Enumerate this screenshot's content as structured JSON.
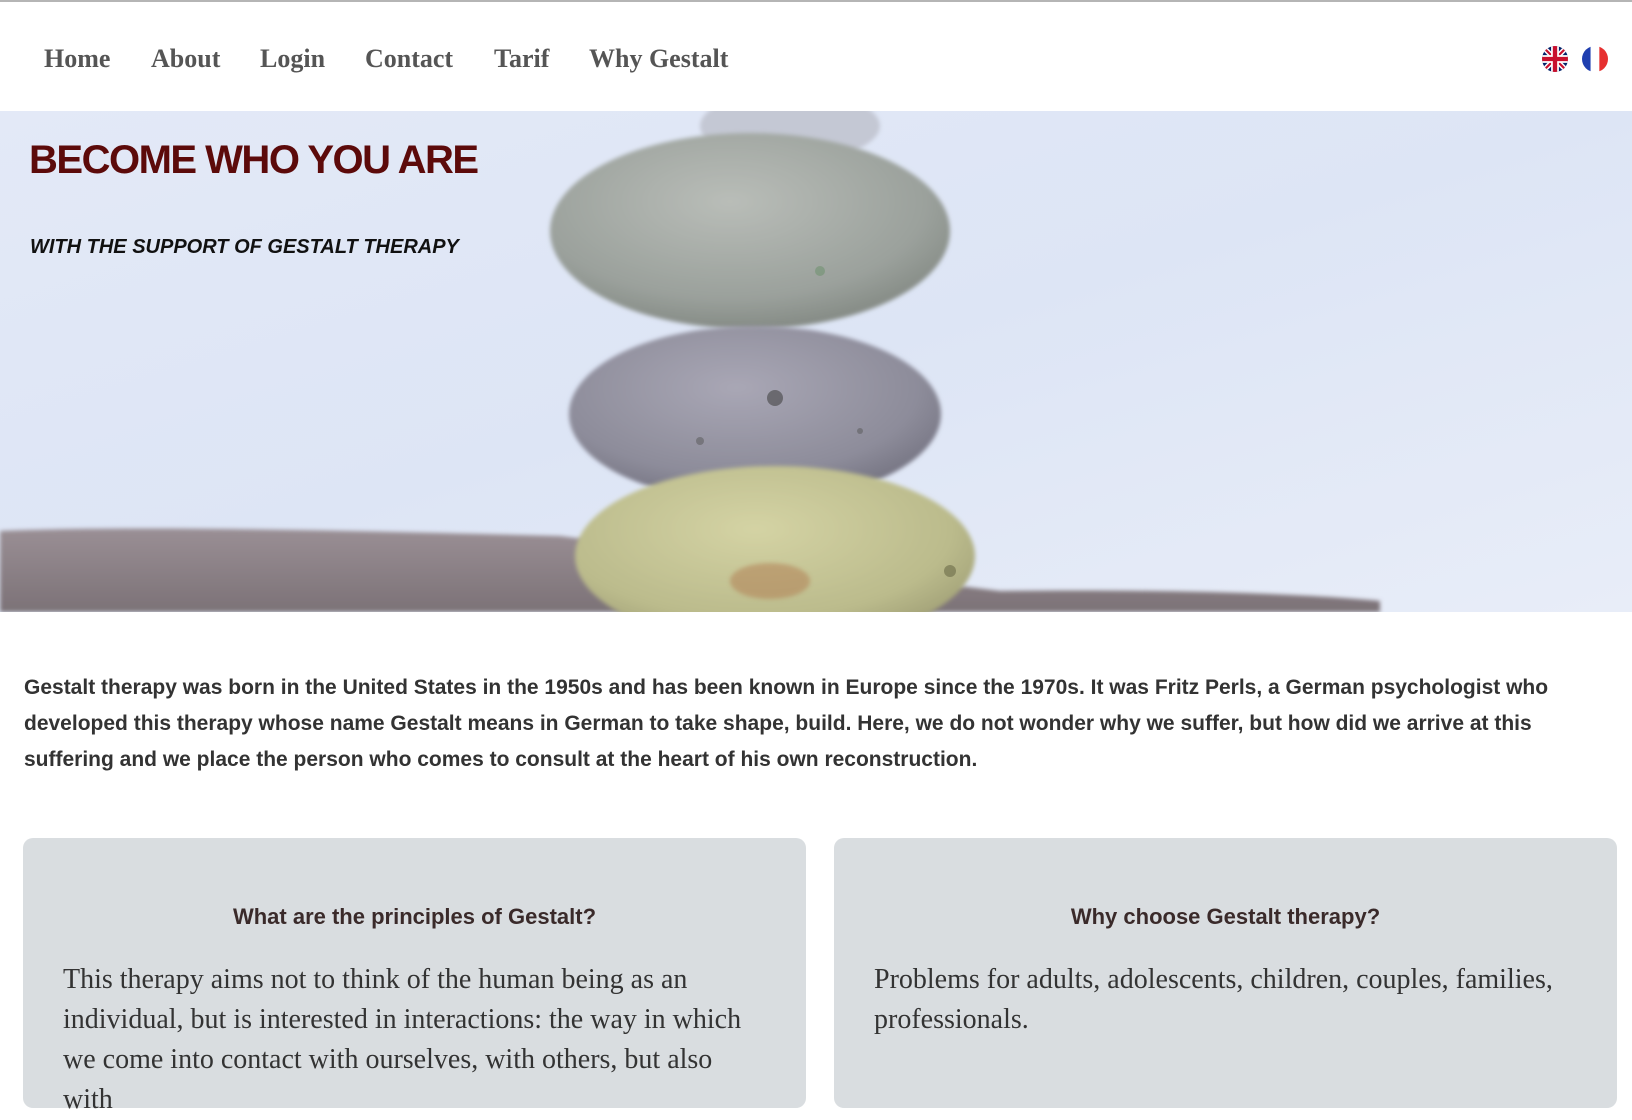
{
  "nav": {
    "items": [
      {
        "label": "Home"
      },
      {
        "label": "About"
      },
      {
        "label": "Login"
      },
      {
        "label": "Contact"
      },
      {
        "label": "Tarif"
      },
      {
        "label": "Why Gestalt"
      }
    ],
    "languages": [
      "english-flag-icon",
      "french-flag-icon"
    ]
  },
  "hero": {
    "title": "BECOME WHO YOU ARE",
    "subtitle": "WITH THE SUPPORT OF GESTALT THERAPY",
    "title_color": "#5c0a0a"
  },
  "intro": {
    "text": "Gestalt therapy was born in the United States in the 1950s and has been known in Europe since the 1970s. It was Fritz Perls, a German psychologist who developed this therapy whose name Gestalt means in German to take shape, build. Here, we do not wonder why we suffer, but how did we arrive at this suffering and we place the person who comes to consult at the heart of his own reconstruction."
  },
  "cards": [
    {
      "title": "What are the principles of Gestalt?",
      "body": "This therapy aims not to think of the human being as an individual, but is interested in interactions: the way in which we come into contact with ourselves, with others, but also with"
    },
    {
      "title": "Why choose Gestalt therapy?",
      "body": "Problems for adults, adolescents, children, couples, families, professionals."
    }
  ],
  "colors": {
    "nav_text": "#555555",
    "card_bg": "#d9dde0",
    "sky": "#dfe6f5"
  }
}
